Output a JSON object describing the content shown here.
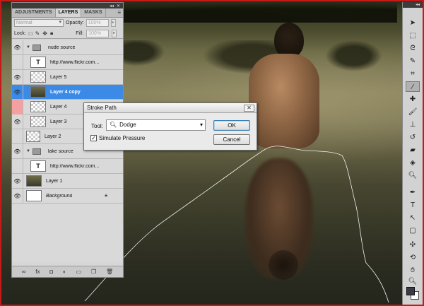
{
  "panel": {
    "tabs": [
      "ADJUSTMENTS",
      "LAYERS",
      "MASKS"
    ],
    "active_tab": "LAYERS",
    "blend_mode": "Normal",
    "opacity_label": "Opacity:",
    "opacity_value": "100%",
    "lock_label": "Lock:",
    "fill_label": "Fill:",
    "fill_value": "100%",
    "layers": [
      {
        "name": "nude source",
        "kind": "group",
        "visible": true
      },
      {
        "name": "http://www.flickr.com...",
        "kind": "text",
        "visible": false
      },
      {
        "name": "Layer 5",
        "kind": "layer",
        "visible": true
      },
      {
        "name": "Layer 4 copy",
        "kind": "layer",
        "visible": true,
        "selected": true
      },
      {
        "name": "Layer 4",
        "kind": "layer",
        "visible": false,
        "highlight": "red"
      },
      {
        "name": "Layer 3",
        "kind": "layer",
        "visible": true
      },
      {
        "name": "Layer 2",
        "kind": "layer",
        "visible": false
      },
      {
        "name": "lake source",
        "kind": "group",
        "visible": true
      },
      {
        "name": "http://www.flickr.com...",
        "kind": "text",
        "visible": false
      },
      {
        "name": "Layer 1",
        "kind": "layer",
        "visible": true
      },
      {
        "name": "Background",
        "kind": "background",
        "visible": true,
        "locked": true
      }
    ],
    "text_thumb_glyph": "T"
  },
  "dialog": {
    "title": "Stroke Path",
    "tool_label": "Tool:",
    "tool_value": "Dodge",
    "simulate_pressure_label": "Simulate Pressure",
    "simulate_pressure_checked": true,
    "check_glyph": "✓",
    "ok_label": "OK",
    "cancel_label": "Cancel",
    "close_glyph": "✕"
  },
  "colors": {
    "selection": "#3b8be6",
    "foreground": "#3a3a46",
    "background": "#ffffff",
    "window_border": "#c41a1a"
  }
}
